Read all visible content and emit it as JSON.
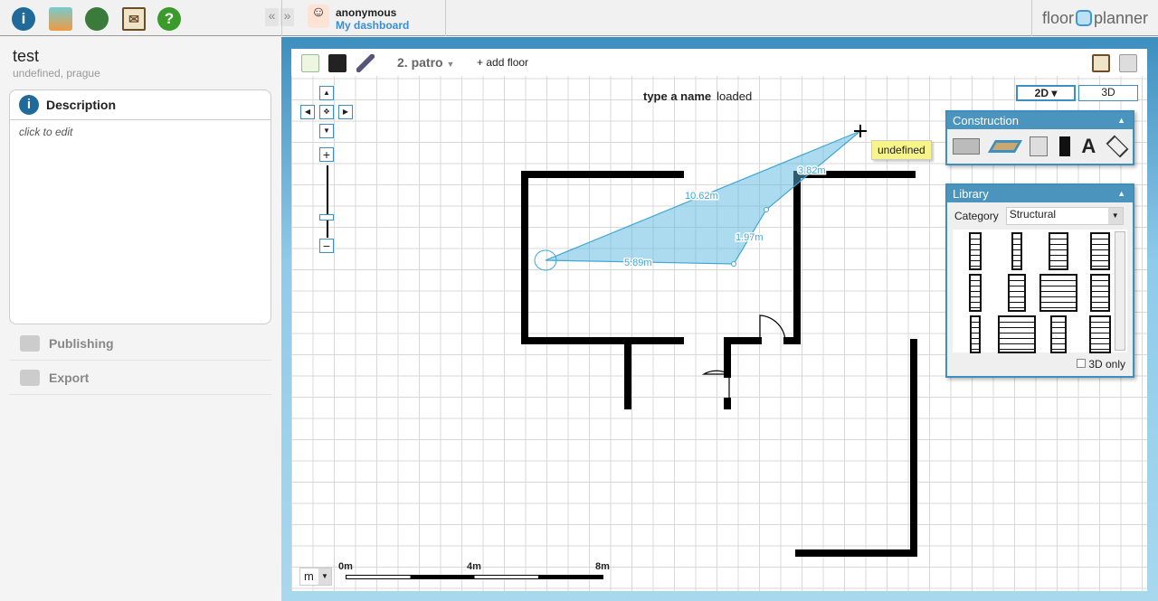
{
  "topbar": {
    "icons": [
      "info-icon",
      "photos-icon",
      "globe-icon",
      "mail-icon",
      "help-icon"
    ],
    "collapse_left": "«",
    "collapse_right": "»",
    "username": "anonymous",
    "dashboard_link": "My dashboard",
    "logo_left": "floor",
    "logo_right": "planner"
  },
  "sidebar": {
    "project_title": "test",
    "project_location": "undefined, prague",
    "description_title": "Description",
    "description_placeholder": "click to edit",
    "items": [
      {
        "label": "Publishing"
      },
      {
        "label": "Export"
      }
    ]
  },
  "toolbar": {
    "floor_name": "2. patro",
    "add_floor": "+ add floor"
  },
  "canvas": {
    "name_label": "type a name",
    "status": "loaded",
    "view_2d": "2D ▾",
    "view_3d": "3D",
    "tooltip": "undefined",
    "measurements": [
      "10.62m",
      "3.82m",
      "1.97m",
      "5.89m"
    ],
    "scale": {
      "unit": "m",
      "labels": [
        "0m",
        "4m",
        "8m"
      ]
    }
  },
  "construction": {
    "title": "Construction",
    "tools": [
      "room-tool-icon",
      "floor-tool-icon",
      "wall-tool-icon",
      "door-tool-icon",
      "text-tool-icon",
      "surface-tool-icon"
    ],
    "text_tool_glyph": "A"
  },
  "library": {
    "title": "Library",
    "category_label": "Category",
    "category_value": "Structural",
    "only3d_label": "3D only"
  },
  "colors": {
    "accent": "#3d8fbf",
    "measure": "#59b7e0",
    "tooltip": "#f7f58a"
  }
}
